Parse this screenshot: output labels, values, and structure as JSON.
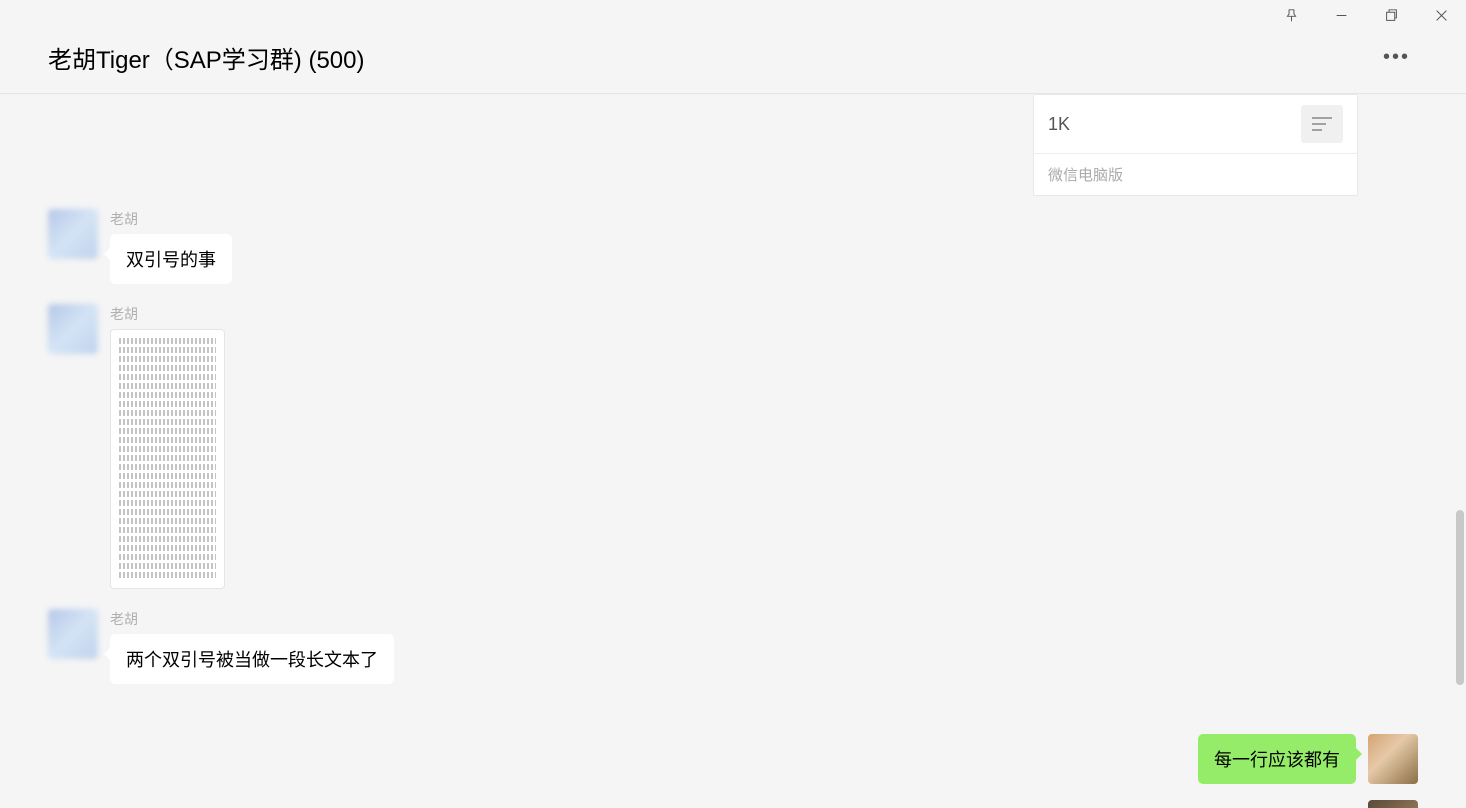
{
  "titlebar": {
    "pin": "pin",
    "minimize": "minimize",
    "maximize": "maximize",
    "close": "close"
  },
  "header": {
    "title": "老胡Tiger（SAP学习群) (500)",
    "more": "•••"
  },
  "card": {
    "count": "1K",
    "footer": "微信电脑版"
  },
  "messages": [
    {
      "sender": "老胡",
      "type": "text",
      "text": "双引号的事"
    },
    {
      "sender": "老胡",
      "type": "image"
    },
    {
      "sender": "老胡",
      "type": "text",
      "text": "两个双引号被当做一段长文本了"
    }
  ],
  "myMessage": {
    "text": "每一行应该都有"
  }
}
